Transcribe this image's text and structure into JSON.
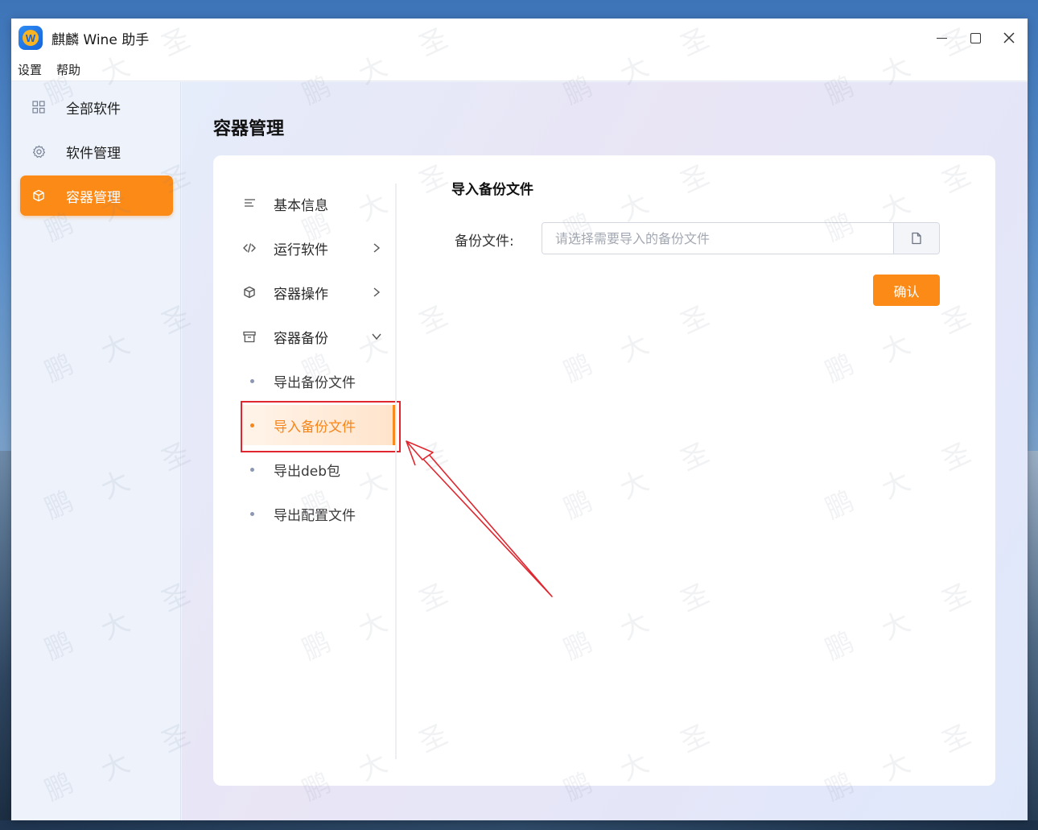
{
  "window": {
    "title": "麒麟 Wine 助手",
    "logo_letter": "W"
  },
  "menu": {
    "settings": "设置",
    "help": "帮助"
  },
  "sidebar": {
    "items": [
      {
        "label": "全部软件",
        "icon": "grid-icon"
      },
      {
        "label": "软件管理",
        "icon": "gear-icon"
      },
      {
        "label": "容器管理",
        "icon": "cube-icon",
        "active": true
      }
    ]
  },
  "page": {
    "title": "容器管理"
  },
  "subnav": {
    "items": [
      {
        "label": "基本信息",
        "icon": "list-icon"
      },
      {
        "label": "运行软件",
        "icon": "code-icon",
        "expand": "collapsed"
      },
      {
        "label": "容器操作",
        "icon": "cube-icon",
        "expand": "collapsed"
      },
      {
        "label": "容器备份",
        "icon": "archive-icon",
        "expand": "expanded"
      }
    ],
    "children": [
      {
        "label": "导出备份文件"
      },
      {
        "label": "导入备份文件",
        "selected": true
      },
      {
        "label": "导出deb包"
      },
      {
        "label": "导出配置文件"
      }
    ]
  },
  "form": {
    "title": "导入备份文件",
    "file_label": "备份文件:",
    "file_placeholder": "请选择需要导入的备份文件",
    "file_value": "",
    "confirm_label": "确认"
  },
  "watermark": {
    "chars": [
      "圣",
      "大",
      "鹏"
    ]
  },
  "colors": {
    "accent": "#fb8a17",
    "annotation": "#e0262e"
  }
}
